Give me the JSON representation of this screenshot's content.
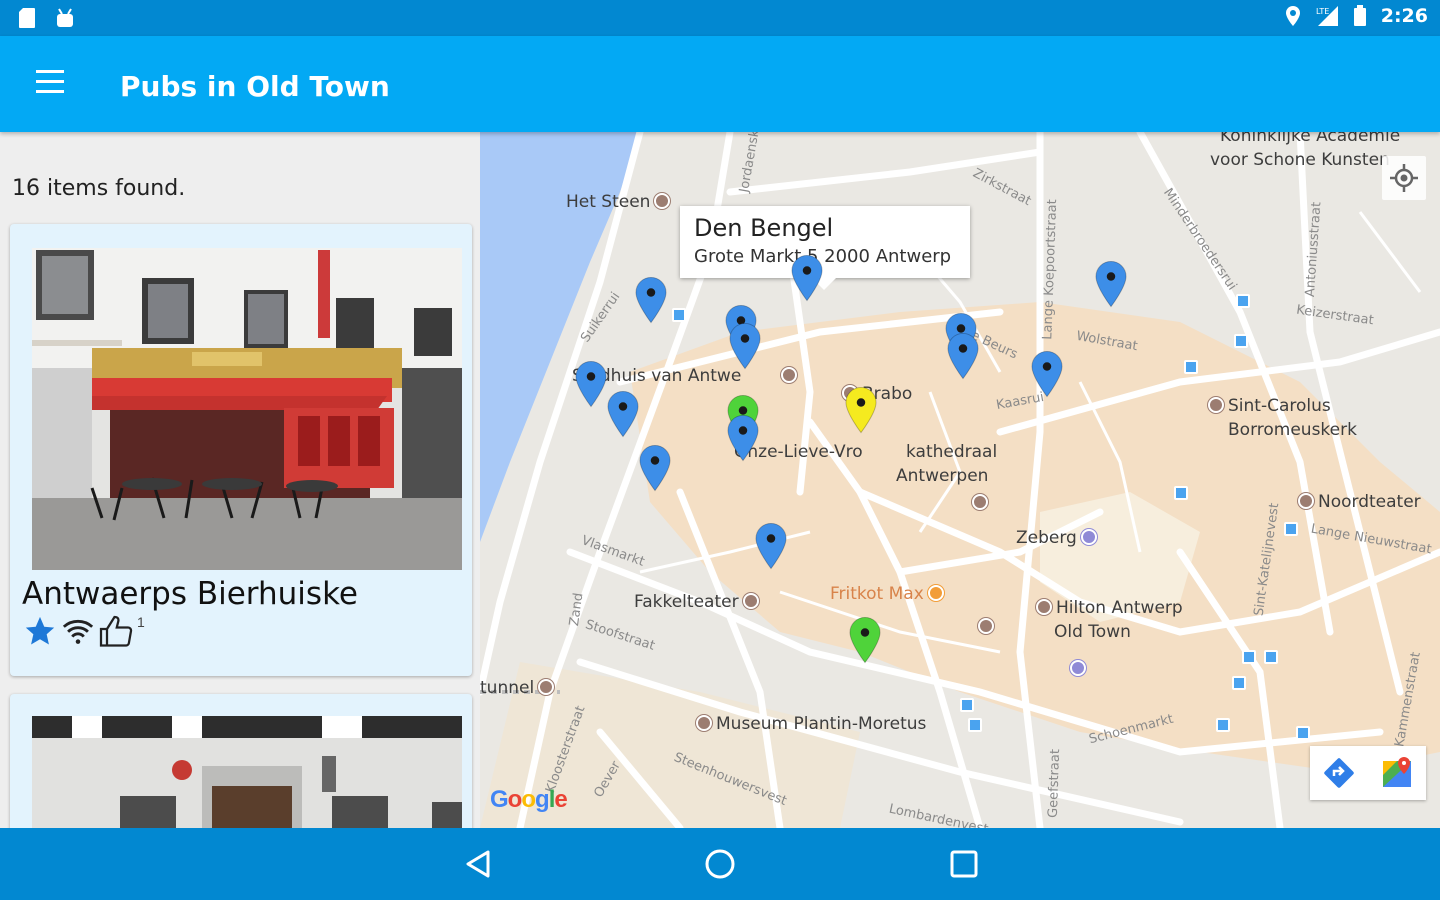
{
  "status_bar": {
    "time": "2:26",
    "left_icons": [
      "sd-card-icon",
      "android-icon"
    ],
    "right_icons": [
      "location-icon",
      "signal-icon",
      "battery-icon"
    ]
  },
  "app_bar": {
    "title": "Pubs in  Old Town",
    "menu_icon": "hamburger-menu-icon",
    "color": "#03a9f4"
  },
  "list": {
    "count_text": "16 items found.",
    "items": [
      {
        "name": "Antwaerps Bierhuiske",
        "rating_icon": "star-icon",
        "wifi_icon": "wifi-icon",
        "like_icon": "thumbs-up-icon",
        "likes": "1"
      },
      {
        "name": ""
      }
    ]
  },
  "map": {
    "info_window": {
      "name": "Den Bengel",
      "address": "Grote Markt 5 2000 Antwerp"
    },
    "places": [
      "Het Steen",
      "Stadhuis van Antwe",
      "Brabo",
      "Onze-Lieve-Vro",
      "kathedraal",
      "Antwerpen",
      "Zeberg",
      "Fakkelteater",
      "Fritkot Max",
      "Hilton Antwerp",
      "Old Town",
      "Museum Plantin-Moretus",
      "Sint-Carolus",
      "Borromeuskerk",
      "Noordteater",
      "Koninklijke Academie",
      "voor Schone Kunsten",
      "tunnel"
    ],
    "streets": [
      "Zirkstraat",
      "Oude Beurs",
      "Kaasrui",
      "Wolstraat",
      "Keizerstraat",
      "Vlasmarkt",
      "Steenhouwersvest",
      "Lombardenvest",
      "Schoenmarkt",
      "Lange Nieuwstraat",
      "Suikerrui",
      "Kloosterstraat",
      "Lange Koepoortstraat",
      "Minderbroedersrui",
      "Sint-Katelijnevest",
      "Jordaenskaai",
      "Zand",
      "Oever",
      "Geefstraat",
      "Kammenstraat",
      "Stoofstraat",
      "Antoniusstraat"
    ],
    "pin_colors": {
      "default": "#3d8ee8",
      "highlight_yellow": "#f5ea1f",
      "highlight_green": "#4fd33a"
    },
    "buttons": {
      "my_location": "my-location-icon",
      "directions": "directions-icon",
      "open_maps": "google-maps-icon"
    },
    "attribution": "Google"
  },
  "nav_bar": {
    "buttons": [
      "back-icon",
      "home-icon",
      "recents-icon"
    ]
  }
}
